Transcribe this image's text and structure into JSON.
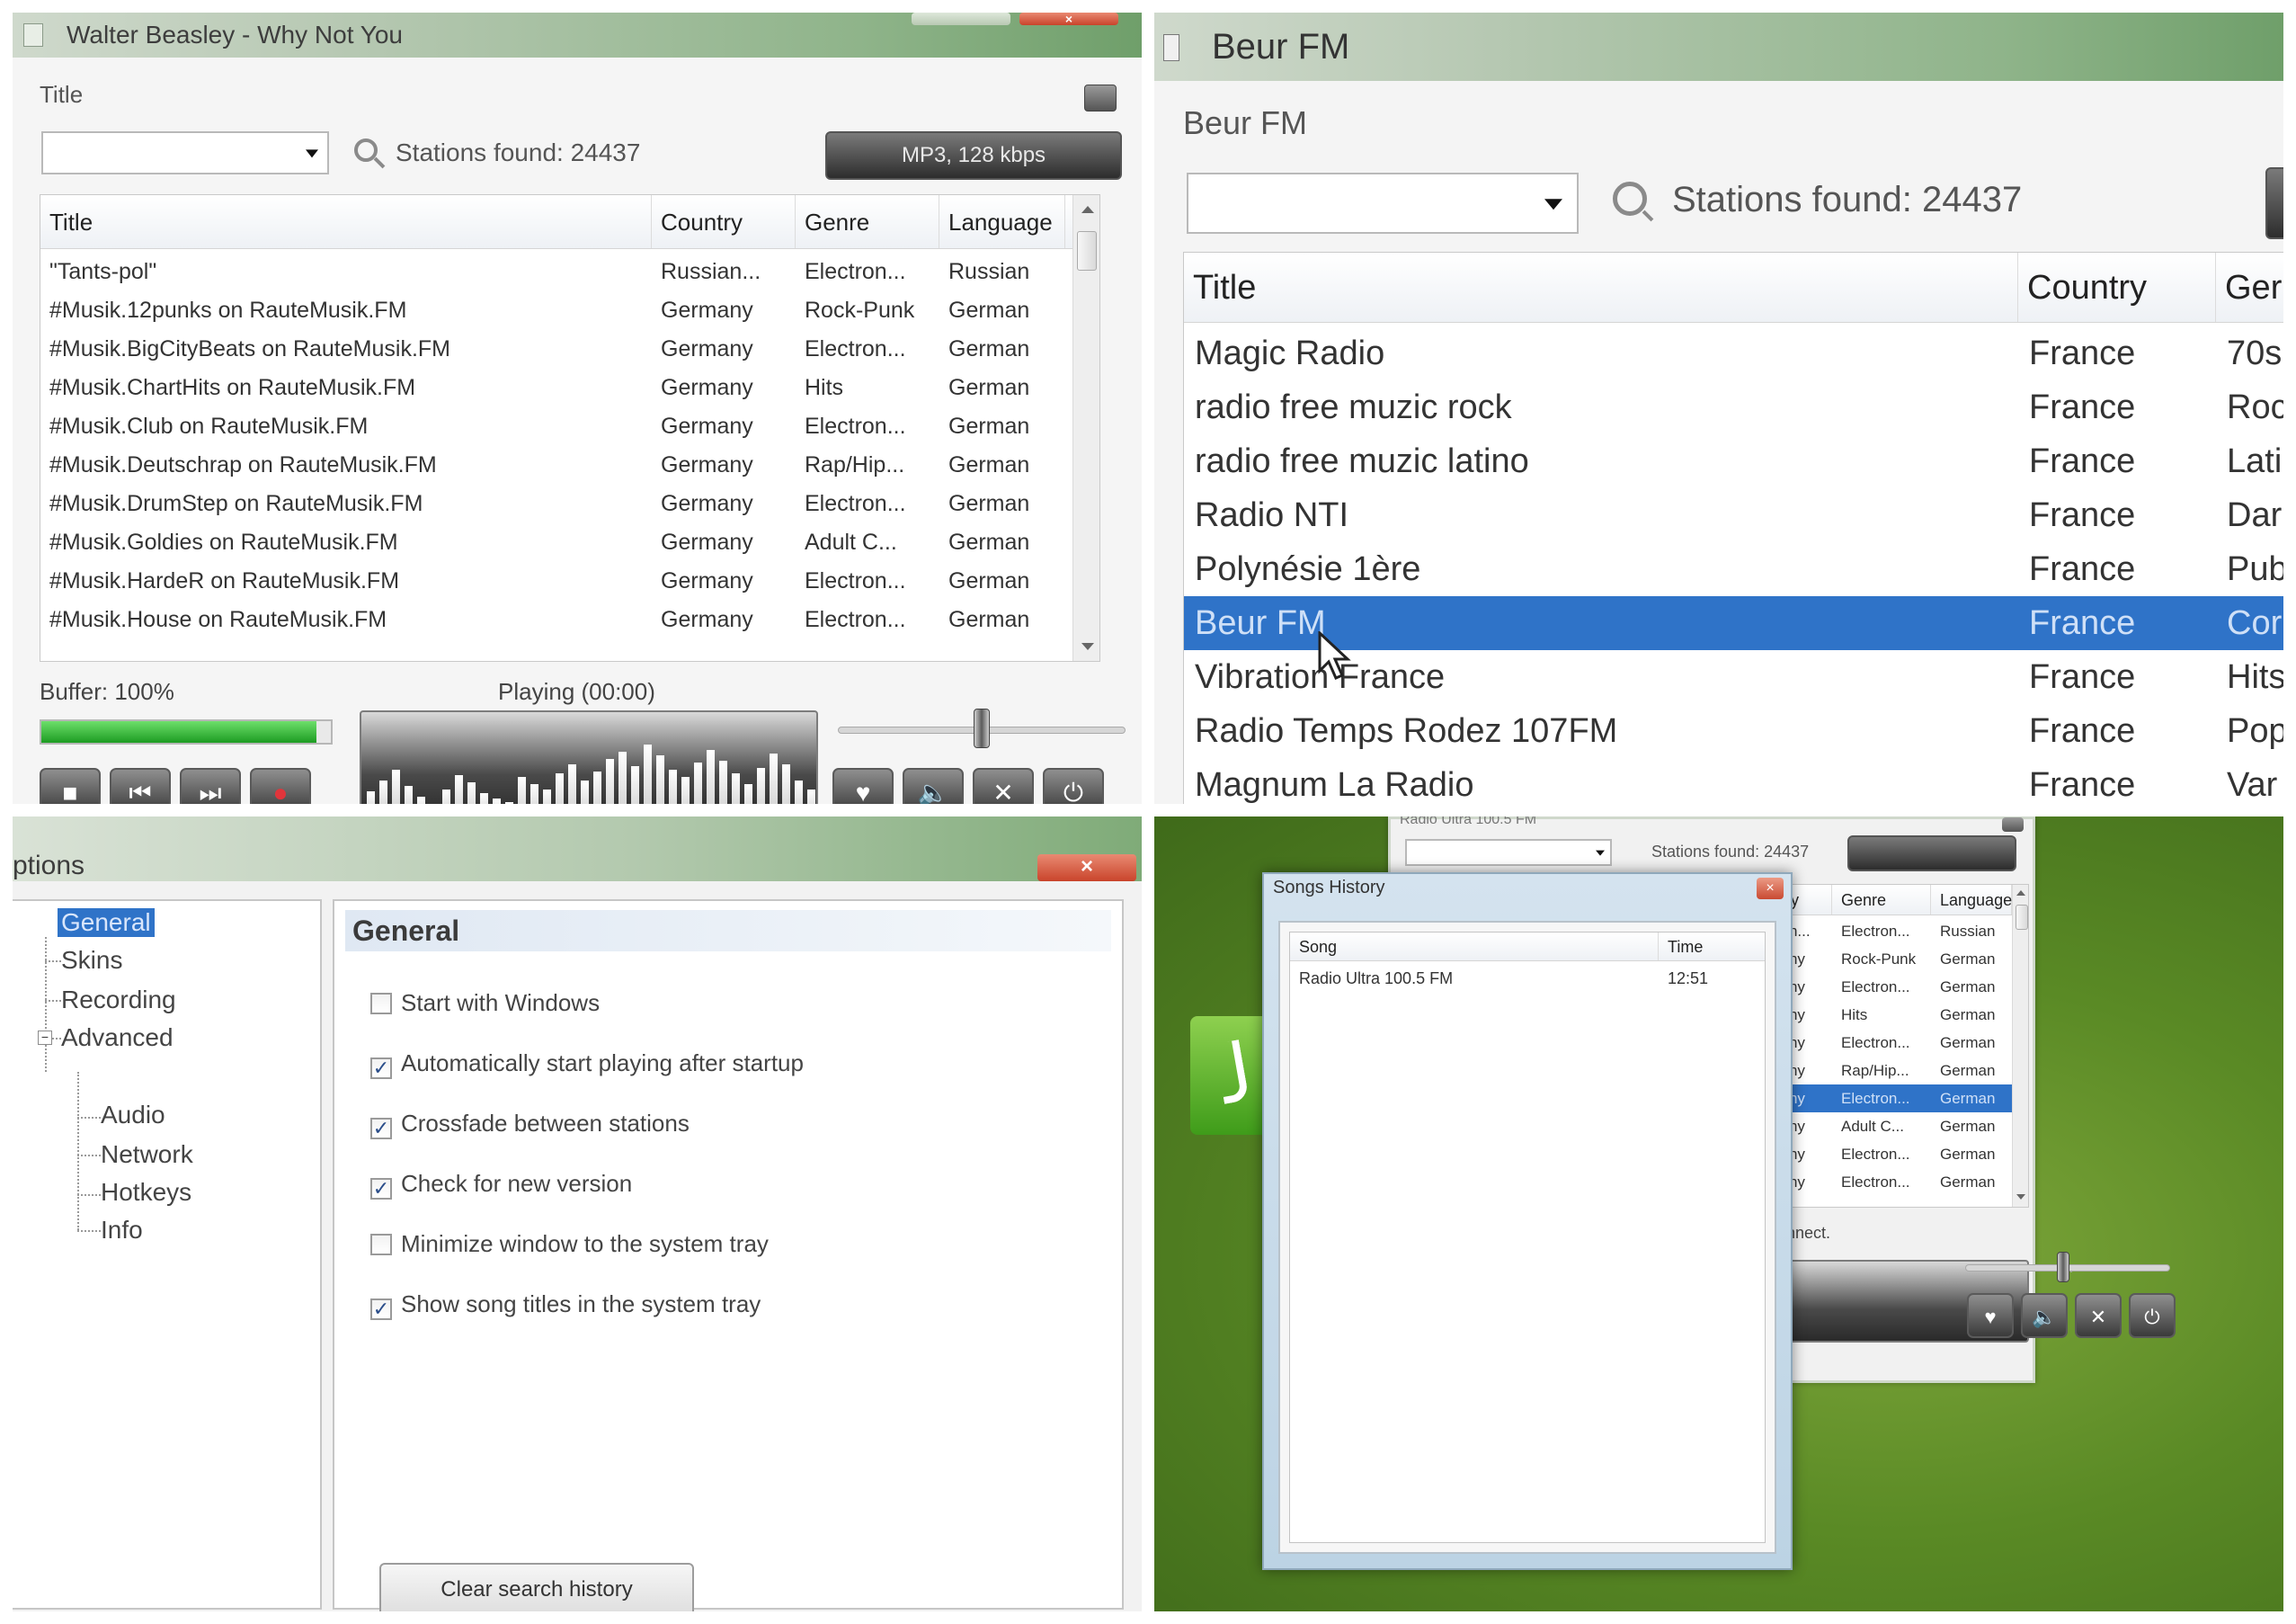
{
  "q1": {
    "window_title": "Walter Beasley - Why Not You",
    "title_label": "Title",
    "stations_found": "Stations found: 24437",
    "format_button": "MP3, 128 kbps",
    "columns": [
      "Title",
      "Country",
      "Genre",
      "Language"
    ],
    "rows": [
      [
        "\"Tants-pol\"",
        "Russian...",
        "Electron...",
        "Russian"
      ],
      [
        "#Musik.12punks on RauteMusik.FM",
        "Germany",
        "Rock-Punk",
        "German"
      ],
      [
        "#Musik.BigCityBeats on RauteMusik.FM",
        "Germany",
        "Electron...",
        "German"
      ],
      [
        "#Musik.ChartHits on RauteMusik.FM",
        "Germany",
        "Hits",
        "German"
      ],
      [
        "#Musik.Club on RauteMusik.FM",
        "Germany",
        "Electron...",
        "German"
      ],
      [
        "#Musik.Deutschrap on RauteMusik.FM",
        "Germany",
        "Rap/Hip...",
        "German"
      ],
      [
        "#Musik.DrumStep on RauteMusik.FM",
        "Germany",
        "Electron...",
        "German"
      ],
      [
        "#Musik.Goldies on RauteMusik.FM",
        "Germany",
        "Adult C...",
        "German"
      ],
      [
        "#Musik.HardeR on RauteMusik.FM",
        "Germany",
        "Electron...",
        "German"
      ],
      [
        "#Musik.House on RauteMusik.FM",
        "Germany",
        "Electron...",
        "German"
      ]
    ],
    "buffer": "Buffer: 100%",
    "buffer_progress": 0.95,
    "playing": "Playing (00:00)",
    "volume": 0.5
  },
  "q2": {
    "window_title": "Beur FM",
    "title_label": "Beur FM",
    "stations_found": "Stations found: 24437",
    "columns": [
      "Title",
      "Country",
      "Ger"
    ],
    "rows": [
      [
        "Magic Radio",
        "France",
        "70s"
      ],
      [
        "radio free muzic rock",
        "France",
        "Roc"
      ],
      [
        "radio free muzic latino",
        "France",
        "Lati"
      ],
      [
        "Radio NTI",
        "France",
        "Dar"
      ],
      [
        "Polynésie 1ère",
        "France",
        "Pub"
      ],
      [
        "Beur FM",
        "France",
        "Cor"
      ],
      [
        "Vibration France",
        "France",
        "Hits"
      ],
      [
        "Radio Temps Rodez 107FM",
        "France",
        "Pop"
      ],
      [
        "Magnum La Radio",
        "France",
        "Var"
      ]
    ],
    "selected_index": 5
  },
  "q3": {
    "window_title": "ptions",
    "tree": [
      "General",
      "Skins",
      "Recording",
      "Advanced",
      "Audio",
      "Network",
      "Hotkeys",
      "Info"
    ],
    "panel_title": "General",
    "checkboxes": [
      {
        "label": "Start with Windows",
        "checked": false
      },
      {
        "label": "Automatically start playing after startup",
        "checked": true
      },
      {
        "label": "Crossfade between stations",
        "checked": true
      },
      {
        "label": "Check for new version",
        "checked": true
      },
      {
        "label": "Minimize window to the system tray",
        "checked": false
      },
      {
        "label": "Show song titles in the system tray",
        "checked": true
      }
    ],
    "clear_button": "Clear search history"
  },
  "q4": {
    "bg_title": "Radio Ultra 100.5 FM",
    "bg_stations_found": "Stations found: 24437",
    "bg_columns": [
      "Country",
      "Genre",
      "Language"
    ],
    "bg_rows": [
      [
        "Russian...",
        "Electron...",
        "Russian"
      ],
      [
        "Germany",
        "Rock-Punk",
        "German"
      ],
      [
        "Germany",
        "Electron...",
        "German"
      ],
      [
        "Germany",
        "Hits",
        "German"
      ],
      [
        "Germany",
        "Electron...",
        "German"
      ],
      [
        "Germany",
        "Rap/Hip...",
        "German"
      ],
      [
        "Germany",
        "Electron...",
        "German"
      ],
      [
        "Germany",
        "Adult C...",
        "German"
      ],
      [
        "Germany",
        "Electron...",
        "German"
      ],
      [
        "Germany",
        "Electron...",
        "German"
      ]
    ],
    "bg_selected_index": 6,
    "bg_status": "onnect.",
    "dialog_title": "Songs History",
    "dialog_columns": [
      "Song",
      "Time"
    ],
    "dialog_rows": [
      [
        "Radio Ultra 100.5 FM",
        "12:51"
      ]
    ]
  }
}
